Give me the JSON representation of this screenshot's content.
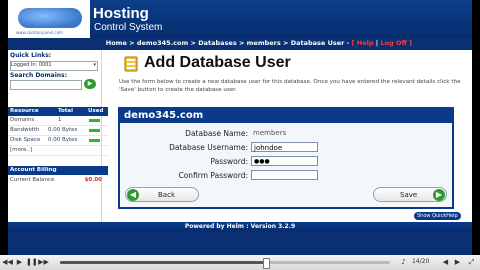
{
  "header": {
    "logo_sub": "www.control-panel.com",
    "brand_line1": "Hosting",
    "brand_line2": "Control System"
  },
  "breadcrumb": {
    "path": "Home > demo345.com > Databases > members > Database User - ",
    "help": "[ Help",
    "sep": " | ",
    "logoff": "Log Off ]"
  },
  "sidebar": {
    "quick_links_label": "Quick Links:",
    "quick_links_value": "Logged In: 0001",
    "search_label": "Search Domains:",
    "go": "▶",
    "resources": {
      "headers": [
        "Resource",
        "Total",
        "Used"
      ],
      "rows": [
        {
          "name": "Domains",
          "total": "1",
          "used": 0.9
        },
        {
          "name": "Bandwidth",
          "total": "0.00 Bytes",
          "used": 0.9
        },
        {
          "name": "Disk Space",
          "total": "0.00 Bytes",
          "used": 0.9
        },
        {
          "name": "[more..]",
          "total": "",
          "used": null
        }
      ]
    },
    "billing_label": "Account Billing",
    "balance_label": "Current Balance",
    "balance_value": "$0.00"
  },
  "main": {
    "title": "Add Database User",
    "description": "Use the form below to create a new database user for this database. Once you have entered the relevant details click the 'Save' button to create the database user.",
    "panel_title": "demo345.com",
    "form": {
      "db_name_label": "Database Name:",
      "db_name_value": "members",
      "username_label": "Database Username:",
      "username_value": "johndoe",
      "password_label": "Password:",
      "password_value": "●●●",
      "confirm_label": "Confirm Password:",
      "confirm_value": ""
    },
    "back_label": "Back",
    "save_label": "Save"
  },
  "quickhelp": "Show QuickHelp",
  "footer": "Powered by Helm : Version 3.2.9",
  "player": {
    "pages": "14/20",
    "progress": 0.62
  }
}
